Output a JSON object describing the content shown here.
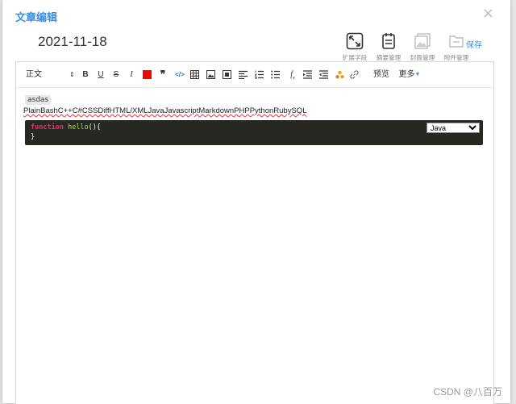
{
  "dialog": {
    "title": "文章编辑",
    "close": "×"
  },
  "article": {
    "date": "2021-11-18"
  },
  "actions": {
    "expand": "扩展字段",
    "summary": "摘要管理",
    "cover": "封面管理",
    "attachments": "附件管理",
    "save": "保存"
  },
  "toolbar": {
    "format_value": "正文",
    "bold": "B",
    "underline": "U",
    "strike": "S",
    "italic": "I",
    "font_color": "#ff0000",
    "quote": "❞",
    "code": "</>",
    "preview": "预览",
    "more": "更多"
  },
  "content": {
    "tag_text": "asdas",
    "languages_line": "PlainBashC++C#CSSDiffHTML/XMLJavaJavascriptMarkdownPHPPythonRubySQL",
    "code_keyword": "function",
    "code_name": "hello",
    "code_rest": "(){",
    "code_line2": "}",
    "code_language": "Java",
    "language_options": [
      "Java"
    ]
  },
  "watermark": "CSDN @八百万",
  "colors": {
    "accent": "#3a8ee6",
    "code_bg": "#272822"
  }
}
